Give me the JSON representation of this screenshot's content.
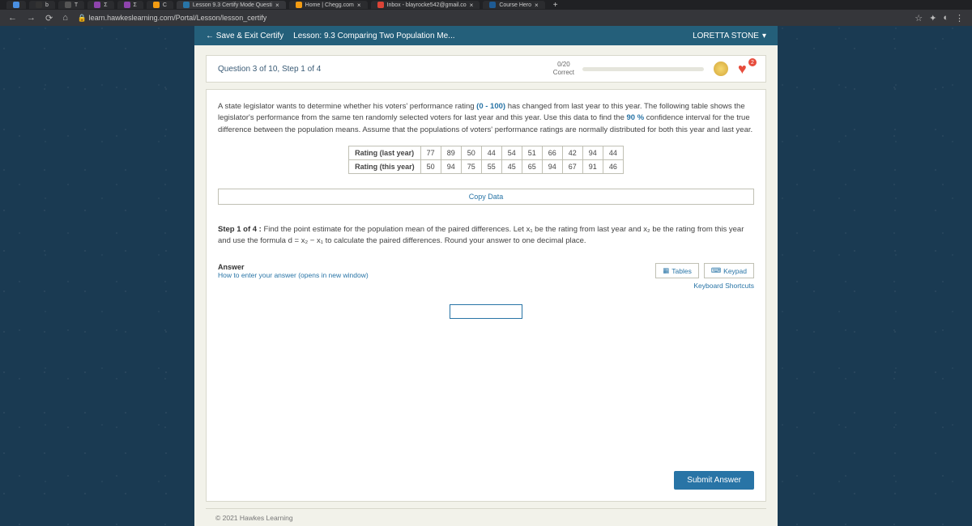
{
  "browser": {
    "tabs": [
      {
        "label": "",
        "fav": "#4a90e2"
      },
      {
        "label": "b",
        "fav": "#333"
      },
      {
        "label": "T",
        "fav": "#555"
      },
      {
        "label": "Σ",
        "fav": "#8e44ad"
      },
      {
        "label": "Σ",
        "fav": "#8e44ad"
      },
      {
        "label": "C",
        "fav": "#f39c12"
      },
      {
        "label": "Lesson 9.3 Certify Mode Questi",
        "fav": "#2874a6",
        "active": true
      },
      {
        "label": "Home | Chegg.com",
        "fav": "#f39c12"
      },
      {
        "label": "Inbox - blayrocke542@gmail.co",
        "fav": "#db4437"
      },
      {
        "label": "Course Hero",
        "fav": "#1e5b94"
      }
    ],
    "url": "learn.hawkeslearning.com/Portal/Lesson/lesson_certify"
  },
  "top": {
    "save_exit": "Save & Exit Certify",
    "lesson_title": "Lesson: 9.3 Comparing Two Population Me...",
    "user_name": "LORETTA STONE"
  },
  "header": {
    "question_label": "Question 3 of 10, Step 1 of 4",
    "score_num": "0/20",
    "score_label": "Correct",
    "hearts": "2"
  },
  "prompt": {
    "p1a": "A state legislator wants to determine whether his voters' performance rating ",
    "range": "(0 - 100)",
    "p1b": " has changed from last year to this year.  The following table shows the legislator's performance from the same ten randomly selected voters for last year and this year.  Use this data to find the ",
    "conf": "90 %",
    "p1c": " confidence interval for the true difference between the population means.  Assume that the populations of voters' performance ratings are normally distributed for both this year and last year."
  },
  "table": {
    "row1_label": "Rating (last year)",
    "row1": [
      "77",
      "89",
      "50",
      "44",
      "54",
      "51",
      "66",
      "42",
      "94",
      "44"
    ],
    "row2_label": "Rating (this year)",
    "row2": [
      "50",
      "94",
      "75",
      "55",
      "45",
      "65",
      "94",
      "67",
      "91",
      "46"
    ]
  },
  "copy_data": "Copy Data",
  "step": {
    "label": "Step 1 of 4 :",
    "text": "  Find the point estimate for the population mean of the paired differences. Let x₁ be the rating from last year and x₂ be the rating from this year and use the formula d = x₂ − x₁ to calculate the paired differences. Round your answer to one decimal place."
  },
  "answer": {
    "label": "Answer",
    "how": "How to enter your answer (opens in new window)",
    "tables": "Tables",
    "keypad": "Keypad",
    "shortcuts": "Keyboard Shortcuts"
  },
  "submit": "Submit Answer",
  "footer": "© 2021 Hawkes Learning"
}
